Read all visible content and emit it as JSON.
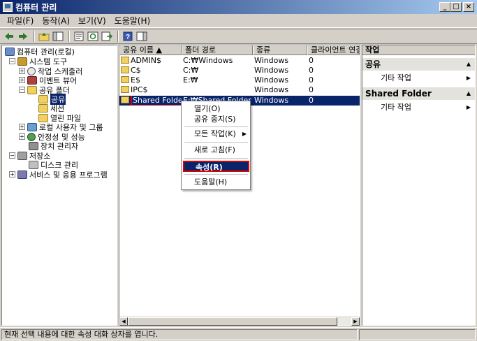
{
  "window": {
    "title": "컴퓨터 관리"
  },
  "menubar": {
    "items": [
      "파일(F)",
      "동작(A)",
      "보기(V)",
      "도움말(H)"
    ]
  },
  "toolbar": {
    "icons": [
      "back-arrow-icon",
      "forward-arrow-icon",
      "up-folder-icon",
      "show-tree-icon",
      "properties-icon",
      "refresh-icon",
      "export-icon",
      "help-icon",
      "action-pane-icon"
    ]
  },
  "tree": {
    "items": [
      {
        "label": "컴퓨터 관리(로컬)",
        "icon": "computer-icon"
      },
      {
        "label": "시스템 도구",
        "icon": "tools-icon"
      },
      {
        "label": "작업 스케줄러",
        "icon": "clock-icon"
      },
      {
        "label": "이벤트 뷰어",
        "icon": "event-viewer-icon"
      },
      {
        "label": "공유 폴더",
        "icon": "shared-folder-icon"
      },
      {
        "label": "공유",
        "icon": "share-icon"
      },
      {
        "label": "세션",
        "icon": "session-icon"
      },
      {
        "label": "열린 파일",
        "icon": "open-files-icon"
      },
      {
        "label": "로컬 사용자 및 그룹",
        "icon": "users-icon"
      },
      {
        "label": "안정성 및 성능",
        "icon": "performance-icon"
      },
      {
        "label": "장치 관리자",
        "icon": "device-manager-icon"
      },
      {
        "label": "저장소",
        "icon": "storage-icon"
      },
      {
        "label": "디스크 관리",
        "icon": "disk-icon"
      },
      {
        "label": "서비스 및 응용 프로그램",
        "icon": "services-icon"
      }
    ]
  },
  "list": {
    "columns": [
      "공유 이름 ▲",
      "폴더 경로",
      "종류",
      "클라이언트 연결"
    ],
    "rows": [
      {
        "name": "ADMIN$",
        "path": "C:₩Windows",
        "type": "Windows",
        "clients": "0"
      },
      {
        "name": "C$",
        "path": "C:₩",
        "type": "Windows",
        "clients": "0"
      },
      {
        "name": "E$",
        "path": "E:₩",
        "type": "Windows",
        "clients": "0"
      },
      {
        "name": "IPC$",
        "path": "",
        "type": "Windows",
        "clients": "0"
      },
      {
        "name": "Shared Folder",
        "path": "E:₩Shared Folder",
        "type": "Windows",
        "clients": "0"
      }
    ]
  },
  "actions": {
    "title": "작업",
    "groups": [
      {
        "label": "공유",
        "items": [
          "기타 작업"
        ]
      },
      {
        "label": "Shared Folder",
        "items": [
          "기타 작업"
        ]
      }
    ]
  },
  "context_menu": {
    "items": [
      "열기(O)",
      "공유 중지(S)",
      "모든 작업(K)",
      "새로 고침(F)",
      "속성(R)",
      "도움말(H)"
    ]
  },
  "status": {
    "text": "현재 선택 내용에 대한 속성 대화 상자를 엽니다."
  },
  "colors": {
    "selection": "#0a246a",
    "highlight_border": "#e00000",
    "face": "#d4d0c8"
  }
}
